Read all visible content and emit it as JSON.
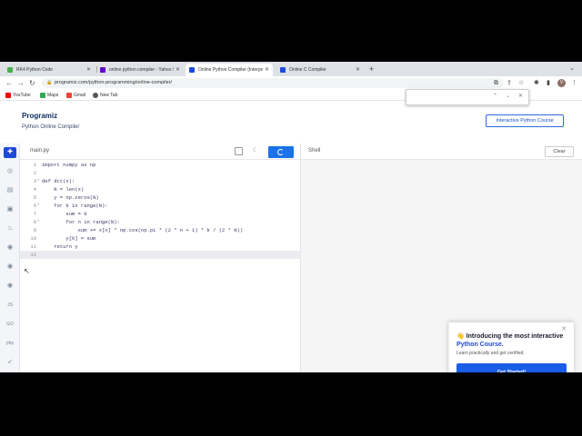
{
  "browser": {
    "tabs": [
      {
        "title": "RK4 Python Code",
        "active": false,
        "favicon_color": "#4caf50"
      },
      {
        "title": "online python compiler - Yahoo Se",
        "active": false,
        "favicon_color": "#6001d2"
      },
      {
        "title": "Online Python Compiler (Interprete",
        "active": true,
        "favicon_color": "#1f4ad8"
      },
      {
        "title": "Online C Compiler",
        "active": false,
        "favicon_color": "#1f4ad8"
      }
    ],
    "new_tab_symbol": "+",
    "url": "programiz.com/python-programming/online-compiler/",
    "avatar_letter": "V",
    "bookmarks": [
      {
        "label": "YouTube",
        "color": "#ff0000"
      },
      {
        "label": "Maps",
        "color": "#34a853"
      },
      {
        "label": "Gmail",
        "color": "#ea4335"
      },
      {
        "label": "New Tab",
        "color": "#555555"
      }
    ]
  },
  "site": {
    "logo": "Programiz",
    "subtitle": "Python Online Compiler",
    "course_button": "Interactive Python Course"
  },
  "editor": {
    "filename": "main.py",
    "lines": [
      {
        "num": "1",
        "text": "import numpy as np",
        "fold": ""
      },
      {
        "num": "2",
        "text": "",
        "fold": ""
      },
      {
        "num": "3",
        "text": "def dct(x):",
        "fold": "▾"
      },
      {
        "num": "4",
        "text": "    N = len(x)",
        "fold": ""
      },
      {
        "num": "5",
        "text": "    y = np.zeros(N)",
        "fold": ""
      },
      {
        "num": "6",
        "text": "    for k in range(N):",
        "fold": "▾"
      },
      {
        "num": "7",
        "text": "        sum = 0",
        "fold": ""
      },
      {
        "num": "8",
        "text": "        for n in range(N):",
        "fold": "▾"
      },
      {
        "num": "9",
        "text": "            sum += x[n] * np.cos(np.pi * (2 * n + 1) * k / (2 * N))",
        "fold": ""
      },
      {
        "num": "10",
        "text": "        y[k] = sum",
        "fold": ""
      },
      {
        "num": "11",
        "text": "    return y",
        "fold": ""
      },
      {
        "num": "12",
        "text": "",
        "fold": ""
      }
    ]
  },
  "shell": {
    "label": "Shell",
    "clear_button": "Clear"
  },
  "promo": {
    "emoji": "👋",
    "title_prefix": "Introducing the most interactive ",
    "title_highlight": "Python Course",
    "title_suffix": ".",
    "subtitle": "Learn practically and get certified.",
    "button": "Get Started!"
  },
  "sidebar_icons": [
    "python-icon",
    "r-icon",
    "sql-icon",
    "html-icon",
    "java-icon",
    "c-icon",
    "cpp-icon",
    "csharp-icon",
    "js-icon",
    "go-icon",
    "php-icon",
    "swift-icon"
  ]
}
